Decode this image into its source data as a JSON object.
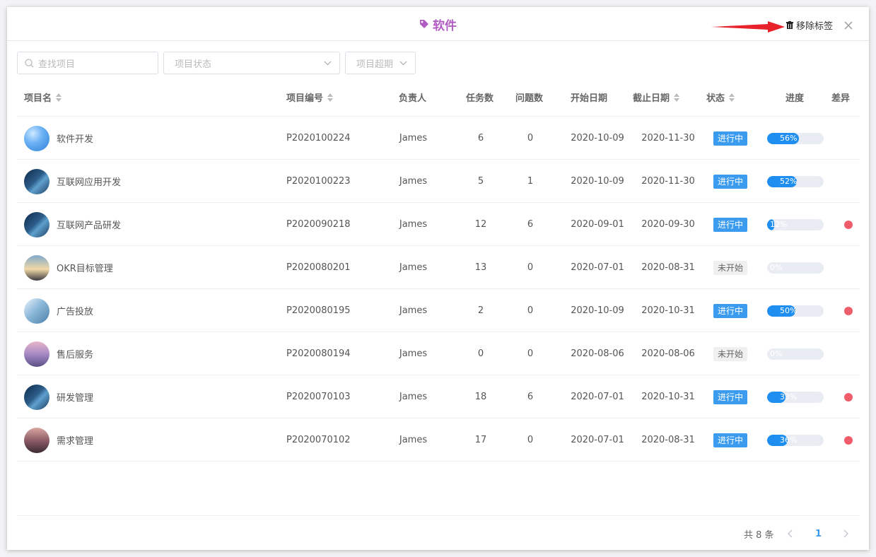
{
  "header": {
    "title": "软件",
    "remove_tag_label": "移除标签"
  },
  "filters": {
    "search_placeholder": "查找项目",
    "status_placeholder": "项目状态",
    "overdue_placeholder": "项目超期"
  },
  "columns": {
    "name": "项目名",
    "code": "项目编号",
    "owner": "负责人",
    "tasks": "任务数",
    "issues": "问题数",
    "start": "开始日期",
    "end": "截止日期",
    "status": "状态",
    "progress": "进度",
    "diff": "差异"
  },
  "rows": [
    {
      "name": "软件开发",
      "code": "P2020100224",
      "owner": "James",
      "tasks": "6",
      "issues": "0",
      "start": "2020-10-09",
      "end": "2020-11-30",
      "status": "进行中",
      "status_type": "active",
      "progress": 56,
      "progress_label": "56%",
      "diff": false,
      "avatar": "sky"
    },
    {
      "name": "互联网应用开发",
      "code": "P2020100223",
      "owner": "James",
      "tasks": "5",
      "issues": "1",
      "start": "2020-10-09",
      "end": "2020-11-30",
      "status": "进行中",
      "status_type": "active",
      "progress": 52,
      "progress_label": "52%",
      "diff": false,
      "avatar": "code"
    },
    {
      "name": "互联网产品研发",
      "code": "P2020090218",
      "owner": "James",
      "tasks": "12",
      "issues": "6",
      "start": "2020-09-01",
      "end": "2020-09-30",
      "status": "进行中",
      "status_type": "active",
      "progress": 12,
      "progress_label": "12%",
      "diff": true,
      "avatar": "code"
    },
    {
      "name": "OKR目标管理",
      "code": "P2020080201",
      "owner": "James",
      "tasks": "13",
      "issues": "0",
      "start": "2020-07-01",
      "end": "2020-08-31",
      "status": "未开始",
      "status_type": "idle",
      "progress": 0,
      "progress_label": "0%",
      "diff": false,
      "avatar": "sunset"
    },
    {
      "name": "广告投放",
      "code": "P2020080195",
      "owner": "James",
      "tasks": "2",
      "issues": "0",
      "start": "2020-10-09",
      "end": "2020-10-31",
      "status": "进行中",
      "status_type": "active",
      "progress": 50,
      "progress_label": "50%",
      "diff": true,
      "avatar": "bridge"
    },
    {
      "name": "售后服务",
      "code": "P2020080194",
      "owner": "James",
      "tasks": "0",
      "issues": "0",
      "start": "2020-08-06",
      "end": "2020-08-06",
      "status": "未开始",
      "status_type": "idle",
      "progress": 0,
      "progress_label": "0%",
      "diff": false,
      "avatar": "purple"
    },
    {
      "name": "研发管理",
      "code": "P2020070103",
      "owner": "James",
      "tasks": "18",
      "issues": "6",
      "start": "2020-07-01",
      "end": "2020-10-31",
      "status": "进行中",
      "status_type": "active",
      "progress": 33,
      "progress_label": "33%",
      "diff": true,
      "avatar": "code"
    },
    {
      "name": "需求管理",
      "code": "P2020070102",
      "owner": "James",
      "tasks": "17",
      "issues": "0",
      "start": "2020-07-01",
      "end": "2020-08-31",
      "status": "进行中",
      "status_type": "active",
      "progress": 36,
      "progress_label": "36%",
      "diff": true,
      "avatar": "street"
    }
  ],
  "pagination": {
    "total_label": "共 8 条",
    "current_page": "1"
  },
  "colors": {
    "title": "#b15cc3",
    "active_badge": "#3a9bef",
    "progress_fill": "#1e8ef0",
    "diff_dot": "#ef5d6a"
  },
  "icons": [
    "tag-icon",
    "trash-icon",
    "close-icon",
    "search-icon",
    "chevron-down-icon",
    "sort-icon",
    "arrow-annotation"
  ]
}
